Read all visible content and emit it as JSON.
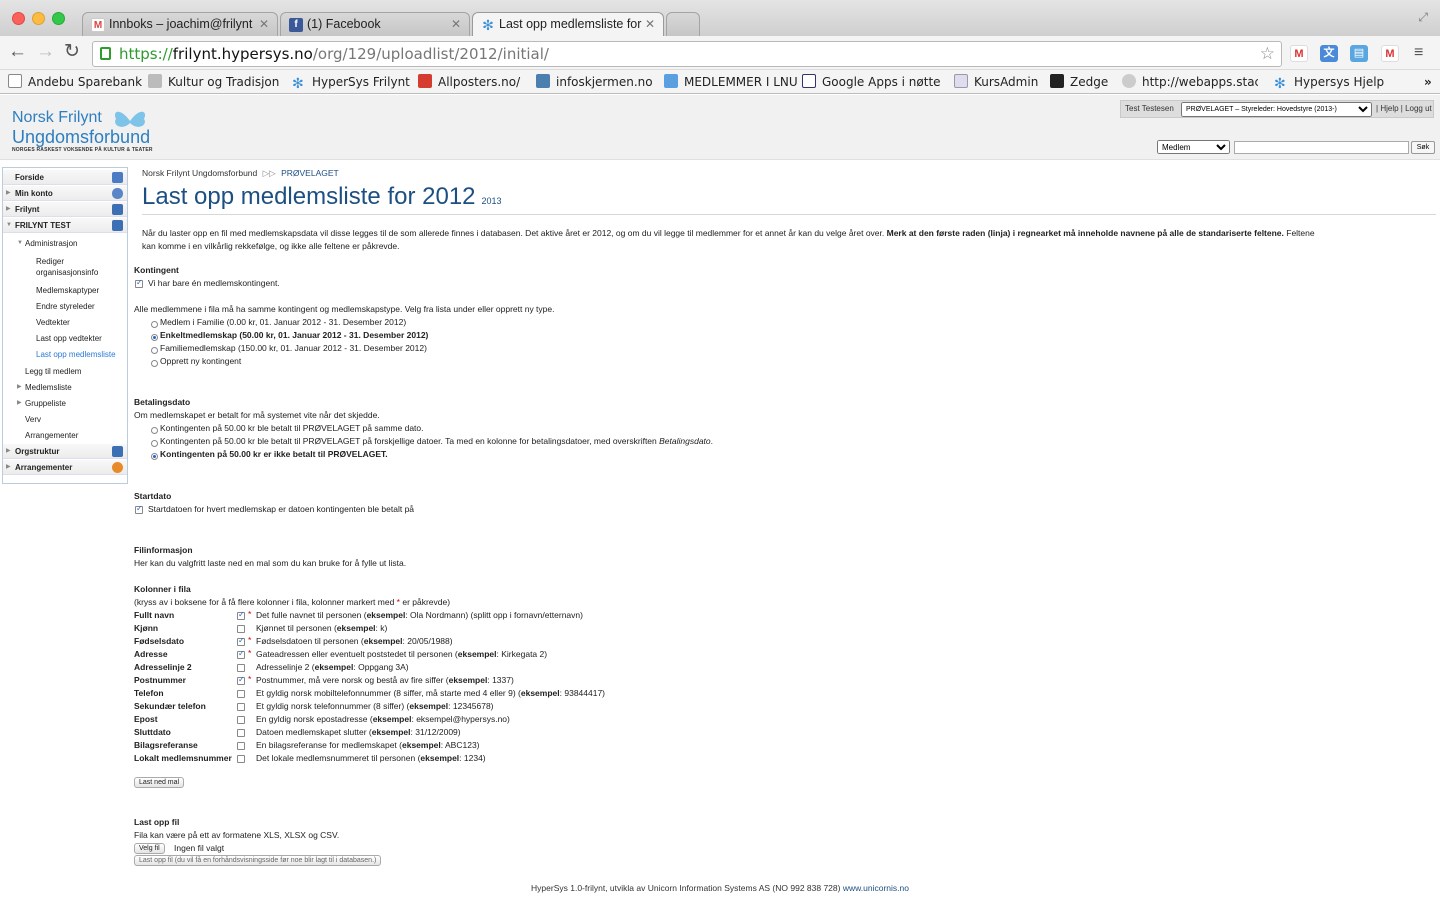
{
  "browser": {
    "tabs": [
      {
        "title": "Innboks – joachim@frilynt",
        "icon": "gmail-icon",
        "active": false
      },
      {
        "title": "(1) Facebook",
        "icon": "facebook-icon",
        "active": false
      },
      {
        "title": "Last opp medlemsliste for",
        "icon": "snowflake-icon",
        "active": true
      }
    ],
    "url_scheme": "https://",
    "url_host": "frilynt.hypersys.no",
    "url_path": "/org/129/uploadlist/2012/initial/",
    "bookmarks": [
      {
        "label": "Andebu Sparebank",
        "icon": "page-icon",
        "color": "#555555"
      },
      {
        "label": "Kultur og Tradisjon",
        "icon": "flag-icon",
        "color": "#777777"
      },
      {
        "label": "HyperSys Frilynt",
        "icon": "snowflake-icon",
        "color": "#3a8fd8"
      },
      {
        "label": "Allposters.no/",
        "icon": "ap-icon",
        "color": "#d63b2f"
      },
      {
        "label": "infoskjermen.no",
        "icon": "person-icon",
        "color": "#4a7fb0"
      },
      {
        "label": "MEDLEMMER I LNU",
        "icon": "bucket-icon",
        "color": "#5aa0e0"
      },
      {
        "label": "Google Apps i nøtte",
        "icon": "tbt-icon",
        "color": "#333366"
      },
      {
        "label": "KursAdmin",
        "icon": "window-icon",
        "color": "#8888bb"
      },
      {
        "label": "Zedge",
        "icon": "zedge-icon",
        "color": "#222222"
      },
      {
        "label": "http://webapps.stac",
        "icon": "cloud-icon",
        "color": "#888888"
      },
      {
        "label": "Hypersys Hjelp",
        "icon": "snowflake-icon",
        "color": "#3a8fd8"
      }
    ]
  },
  "header": {
    "logo_line1": "Norsk Frilynt",
    "logo_line2": "Ungdomsforbund",
    "logo_tagline": "NORGES RASKEST VOKSENDE PÅ KULTUR & TEATER",
    "user_name": "Test Testesen",
    "role_select": "PRØVELAGET – Styreleder: Hovedstyre (2013-)",
    "help_link": "Hjelp",
    "logout_link": "Logg ut",
    "search_select": "Medlem",
    "search_button": "Søk"
  },
  "sidebar": {
    "items": [
      {
        "label": "Forside",
        "level": 0,
        "icon": "home-icon"
      },
      {
        "label": "Min konto",
        "level": 0,
        "icon": "user-icon"
      },
      {
        "label": "Frilynt",
        "level": 0,
        "icon": "flag-icon"
      },
      {
        "label": "FRILYNT TEST",
        "level": 0,
        "icon": "flag-icon"
      },
      {
        "label": "Administrasjon",
        "level": 1
      },
      {
        "label": "Rediger",
        "level": 2
      },
      {
        "label": "organisasjonsinfo",
        "level": 2
      },
      {
        "label": "Medlemskaptyper",
        "level": 2
      },
      {
        "label": "Endre styreleder",
        "level": 2
      },
      {
        "label": "Vedtekter",
        "level": 2
      },
      {
        "label": "Last opp vedtekter",
        "level": 2
      },
      {
        "label": "Last opp medlemsliste",
        "level": 2
      },
      {
        "label": "Legg til medlem",
        "level": 1
      },
      {
        "label": "Medlemsliste",
        "level": 1
      },
      {
        "label": "Gruppeliste",
        "level": 1
      },
      {
        "label": "Verv",
        "level": 1
      },
      {
        "label": "Arrangementer",
        "level": 1
      },
      {
        "label": "Orgstruktur",
        "level": 0,
        "icon": "flag-icon"
      },
      {
        "label": "Arrangementer",
        "level": 0,
        "icon": "clock-icon"
      }
    ]
  },
  "main": {
    "breadcrumb_root": "Norsk Frilynt Ungdomsforbund",
    "breadcrumb_sep": "▷▷",
    "breadcrumb_current": "PRØVELAGET",
    "title": "Last opp medlemsliste for 2012",
    "title_year_link": "2013",
    "intro": "Når du laster opp en fil med medlemskapsdata vil disse legges til de som allerede finnes i databasen. Det aktive året er 2012, og om du vil legge til medlemmer for et annet år kan du velge året over. ",
    "intro_bold": "Merk at den første raden (linja) i regnearket må inneholde navnene på alle de standariserte feltene.",
    "intro_tail": " Feltene",
    "intro_line2": "kan komme i en vilkårlig rekkefølge, og ikke alle feltene er påkrevde.",
    "kontingent_heading": "Kontingent",
    "kontingent_checkbox": "Vi har bare én medlemskontingent.",
    "kontingent_info": "Alle medlemmene i fila må ha samme kontingent og medlemskapstype. Velg fra lista under eller opprett ny type.",
    "kontingent_options": [
      {
        "label": "Medlem i Familie (0.00 kr, 01. Januar 2012 - 31. Desember 2012)",
        "selected": false
      },
      {
        "label": "Enkeltmedlemskap (50.00 kr, 01. Januar 2012 - 31. Desember 2012)",
        "selected": true
      },
      {
        "label": "Familiemedlemskap (150.00 kr, 01. Januar 2012 - 31. Desember 2012)",
        "selected": false
      },
      {
        "label": "Opprett ny kontingent",
        "selected": false
      }
    ],
    "betaling_heading": "Betalingsdato",
    "betaling_info": "Om medlemskapet er betalt for må systemet vite når det skjedde.",
    "betaling_opt1": "Kontingenten på 50.00 kr ble betalt til PRØVELAGET på samme dato.",
    "betaling_opt2": "Kontingenten på 50.00 kr ble betalt til PRØVELAGET på forskjellige datoer. Ta med en kolonne for betalingsdatoer, med overskriften ",
    "betaling_opt2_italic": "Betalingsdato",
    "betaling_opt2_end": ".",
    "betaling_opt3": "Kontingenten på 50.00 kr er ikke betalt til PRØVELAGET.",
    "start_heading": "Startdato",
    "start_checkbox": "Startdatoen for hvert medlemskap er datoen kontingenten ble betalt på",
    "fil_heading": "Filinformasjon",
    "fil_info": "Her kan du valgfritt laste ned en mal som du kan bruke for å fylle ut lista.",
    "kol_heading": "Kolonner i fila",
    "kol_info_a": "(kryss av i boksene for å få flere kolonner i fila, kolonner markert med ",
    "kol_info_star": "*",
    "kol_info_b": " er påkrevde)",
    "example_word": "eksempel",
    "columns": [
      {
        "name": "Fullt navn",
        "checked": true,
        "required": true,
        "desc": "Det fulle navnet til personen (",
        "example": "Ola Nordmann) (splitt opp i fornavn/etternavn)"
      },
      {
        "name": "Kjønn",
        "checked": false,
        "required": false,
        "desc": "Kjønnet til personen (",
        "example": "k)"
      },
      {
        "name": "Fødselsdato",
        "checked": true,
        "required": true,
        "desc": "Fødselsdatoen til personen (",
        "example": "20/05/1988)"
      },
      {
        "name": "Adresse",
        "checked": true,
        "required": true,
        "desc": "Gateadressen eller eventuelt poststedet til personen (",
        "example": "Kirkegata 2)"
      },
      {
        "name": "Adresselinje 2",
        "checked": false,
        "required": false,
        "desc": "Adresselinje 2 (",
        "example": "Oppgang 3A)"
      },
      {
        "name": "Postnummer",
        "checked": true,
        "required": true,
        "desc": "Postnummer, må vere norsk og bestå av fire siffer (",
        "example": "1337)"
      },
      {
        "name": "Telefon",
        "checked": false,
        "required": false,
        "desc": "Et gyldig norsk mobiltelefonnummer (8 siffer, må starte med 4 eller 9) (",
        "example": "93844417)"
      },
      {
        "name": "Sekundær telefon",
        "checked": false,
        "required": false,
        "desc": "Et gyldig norsk telefonnummer (8 siffer) (",
        "example": "12345678)"
      },
      {
        "name": "Epost",
        "checked": false,
        "required": false,
        "desc": "En gyldig norsk epostadresse (",
        "example": "eksempel@hypersys.no)"
      },
      {
        "name": "Sluttdato",
        "checked": false,
        "required": false,
        "desc": "Datoen medlemskapet slutter (",
        "example": "31/12/2009)"
      },
      {
        "name": "Bilagsreferanse",
        "checked": false,
        "required": false,
        "desc": "En bilagsreferanse for medlemskapet (",
        "example": "ABC123)"
      },
      {
        "name": "Lokalt medlemsnummer",
        "checked": false,
        "required": false,
        "desc": "Det lokale medlemsnummeret til personen (",
        "example": "1234)"
      }
    ],
    "download_button": "Last ned mal",
    "upload_heading": "Last opp fil",
    "upload_info": "Fila kan være på ett av formatene XLS, XLSX og CSV.",
    "choose_file_button": "Velg fil",
    "no_file_text": "Ingen fil valgt",
    "upload_button": "Last opp fil (du vil få en forhåndsvisningsside før noe blir lagt til i databasen.)"
  },
  "footer": {
    "text": "HyperSys 1.0-frilynt, utvikla av Unicorn Information Systems AS (NO 992 838 728) ",
    "link": "www.unicornis.no"
  }
}
